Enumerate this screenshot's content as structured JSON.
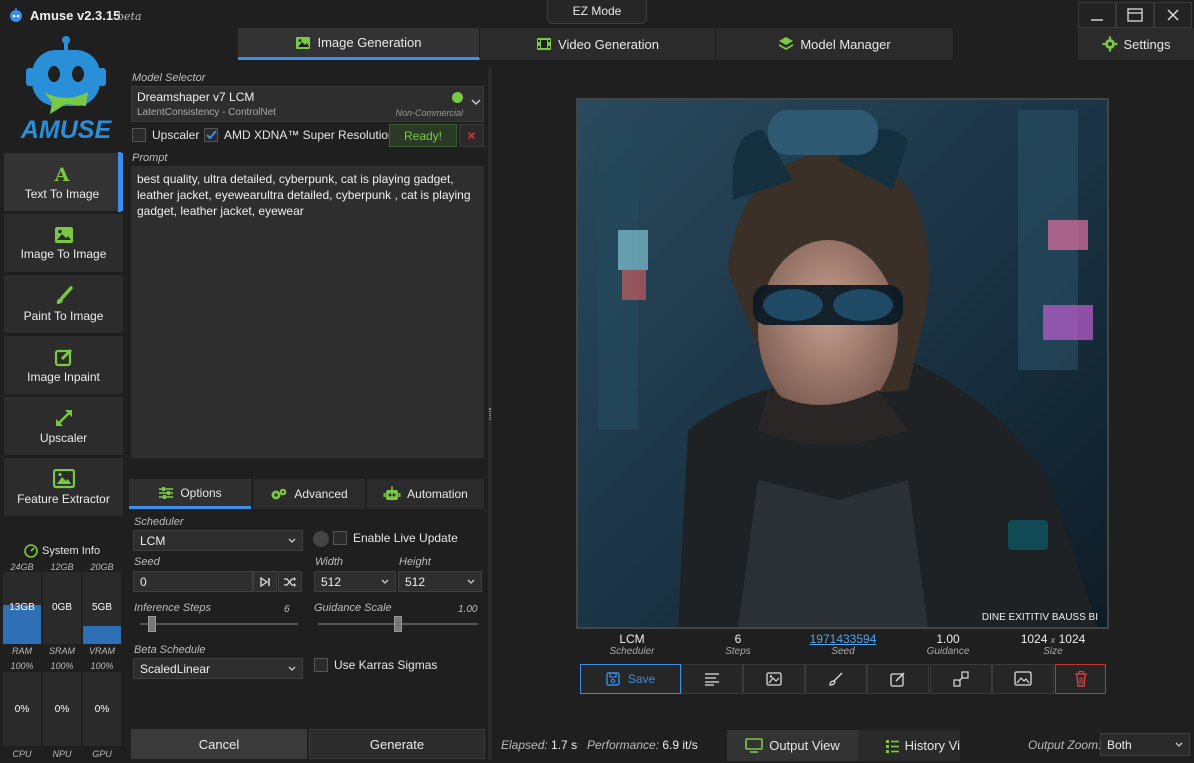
{
  "app": {
    "title": "Amuse v2.3.15",
    "beta": "beta",
    "mode": "EZ Mode",
    "logo_text": "AMUSE"
  },
  "tabs": [
    {
      "label": "Image Generation",
      "icon": "image-icon"
    },
    {
      "label": "Video Generation",
      "icon": "film-icon"
    },
    {
      "label": "Model Manager",
      "icon": "layers-icon"
    }
  ],
  "settings_label": "Settings",
  "sidebar": {
    "items": [
      {
        "label": "Text To Image",
        "icon": "letter-a-icon"
      },
      {
        "label": "Image To Image",
        "icon": "image-icon"
      },
      {
        "label": "Paint To Image",
        "icon": "brush-icon"
      },
      {
        "label": "Image Inpaint",
        "icon": "edit-icon"
      },
      {
        "label": "Upscaler",
        "icon": "expand-icon"
      },
      {
        "label": "Feature Extractor",
        "icon": "gallery-icon"
      }
    ]
  },
  "sysinfo": {
    "title": "System Info",
    "meters": [
      {
        "cap": "24GB",
        "value": "13GB",
        "label": "RAM",
        "fill": 0.54
      },
      {
        "cap": "12GB",
        "value": "0GB",
        "label": "SRAM",
        "fill": 0
      },
      {
        "cap": "20GB",
        "value": "5GB",
        "label": "VRAM",
        "fill": 0.25
      }
    ],
    "usage": [
      {
        "cap": "100%",
        "value": "0%",
        "label": "CPU"
      },
      {
        "cap": "100%",
        "value": "0%",
        "label": "NPU"
      },
      {
        "cap": "100%",
        "value": "0%",
        "label": "GPU"
      }
    ]
  },
  "model": {
    "section_label": "Model Selector",
    "name": "Dreamshaper v7 LCM",
    "sub": "LatentConsistency - ControlNet",
    "license": "Non-Commercial",
    "status_color": "#7ac943"
  },
  "upscaler": {
    "label": "Upscaler",
    "checked": false
  },
  "super_res": {
    "label": "AMD XDNA™ Super Resolution",
    "checked": true,
    "status": "Ready!",
    "clear": "✕"
  },
  "prompt": {
    "label": "Prompt",
    "text": "best quality, ultra detailed, cyberpunk, cat is playing gadget, leather jacket, eyewearultra detailed, cyberpunk , cat is playing gadget, leather jacket, eyewear"
  },
  "subtabs": [
    {
      "label": "Options",
      "icon": "sliders-icon"
    },
    {
      "label": "Advanced",
      "icon": "gears-icon"
    },
    {
      "label": "Automation",
      "icon": "robot-icon"
    }
  ],
  "options": {
    "scheduler_label": "Scheduler",
    "scheduler": "LCM",
    "live_update": "Enable Live Update",
    "seed_label": "Seed",
    "seed": "0",
    "width_label": "Width",
    "width": "512",
    "height_label": "Height",
    "height": "512",
    "steps_label": "Inference Steps",
    "steps": "6",
    "steps_fill": 0.05,
    "guidance_label": "Guidance Scale",
    "guidance": "1.00",
    "guidance_fill": 0.5,
    "beta_label": "Beta Schedule",
    "beta": "ScaledLinear",
    "karras": "Use Karras Sigmas"
  },
  "buttons": {
    "cancel": "Cancel",
    "generate": "Generate"
  },
  "result": {
    "scheduler": "LCM",
    "scheduler_label": "Scheduler",
    "steps": "6",
    "steps_label": "Steps",
    "seed": "1971433594",
    "seed_label": "Seed",
    "guidance": "1.00",
    "guidance_label": "Guidance",
    "size_w": "1024",
    "size_x": "x",
    "size_h": "1024",
    "size_label": "Size",
    "save": "Save",
    "watermark": "DINE EXITITIV BAUSS BI"
  },
  "status": {
    "elapsed_label": "Elapsed:",
    "elapsed": "1.7 s",
    "performance_label": "Performance:",
    "performance": "6.9 it/s",
    "output_view": "Output View",
    "history_view": "History Vi",
    "zoom_label": "Output Zoom:",
    "zoom": "Both"
  }
}
